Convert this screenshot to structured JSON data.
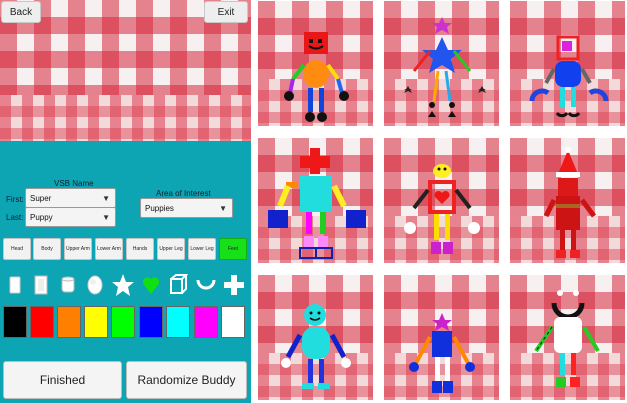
{
  "nav": {
    "back_label": "Back",
    "exit_label": "Exit"
  },
  "form": {
    "vsb_name_label": "VSB Name",
    "first_label": "First:",
    "last_label": "Last:",
    "first_value": "Super",
    "last_value": "Puppy",
    "area_label": "Area of Interest",
    "area_value": "Puppies"
  },
  "parts": [
    {
      "label": "Head",
      "active": false
    },
    {
      "label": "Body",
      "active": false
    },
    {
      "label": "Upper Arm",
      "active": false
    },
    {
      "label": "Lower Arm",
      "active": false
    },
    {
      "label": "Hands",
      "active": false
    },
    {
      "label": "Upper Leg",
      "active": false
    },
    {
      "label": "Lower Leg",
      "active": false
    },
    {
      "label": "Feet",
      "active": true
    }
  ],
  "shapes": [
    "rounded-rect-icon",
    "rect-icon",
    "cylinder-icon",
    "sphere-icon",
    "star-icon",
    "heart-icon",
    "cube-frame-icon",
    "arc-icon",
    "plus-icon"
  ],
  "colors": [
    "#000000",
    "#ff0000",
    "#ff8000",
    "#ffff00",
    "#00ff00",
    "#0000ff",
    "#00ffff",
    "#ff00ff",
    "#ffffff"
  ],
  "actions": {
    "finished_label": "Finished",
    "randomize_label": "Randomize Buddy"
  },
  "gallery": [
    {
      "name": "buddy-gallery-tile"
    },
    {
      "name": "buddy-gallery-tile"
    },
    {
      "name": "buddy-gallery-tile"
    },
    {
      "name": "buddy-gallery-tile"
    },
    {
      "name": "buddy-gallery-tile"
    },
    {
      "name": "buddy-gallery-tile"
    },
    {
      "name": "buddy-gallery-tile"
    },
    {
      "name": "buddy-gallery-tile"
    },
    {
      "name": "buddy-gallery-tile"
    }
  ]
}
